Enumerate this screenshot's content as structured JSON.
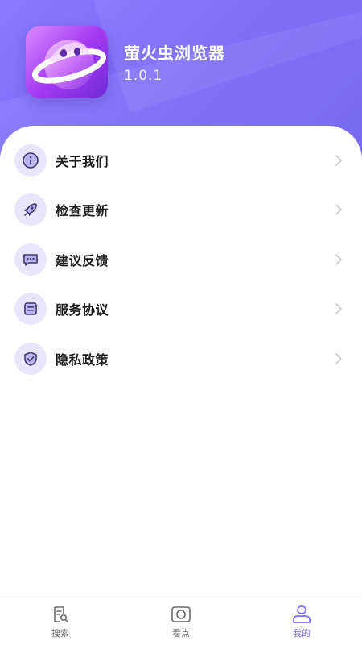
{
  "app": {
    "name": "萤火虫浏览器",
    "version": "1.0.1"
  },
  "menu": {
    "items": [
      {
        "label": "关于我们",
        "icon": "info-icon"
      },
      {
        "label": "检查更新",
        "icon": "rocket-icon"
      },
      {
        "label": "建议反馈",
        "icon": "chat-icon"
      },
      {
        "label": "服务协议",
        "icon": "document-icon"
      },
      {
        "label": "隐私政策",
        "icon": "shield-check-icon"
      }
    ]
  },
  "nav": {
    "items": [
      {
        "label": "搜索",
        "icon": "search-doc-icon",
        "active": false
      },
      {
        "label": "看点",
        "icon": "camera-icon",
        "active": false
      },
      {
        "label": "我的",
        "icon": "user-icon",
        "active": true
      }
    ]
  },
  "colors": {
    "accent": "#7a6af0",
    "icon_bg": "#e9e6fb",
    "icon_stroke": "#3f3a72"
  }
}
